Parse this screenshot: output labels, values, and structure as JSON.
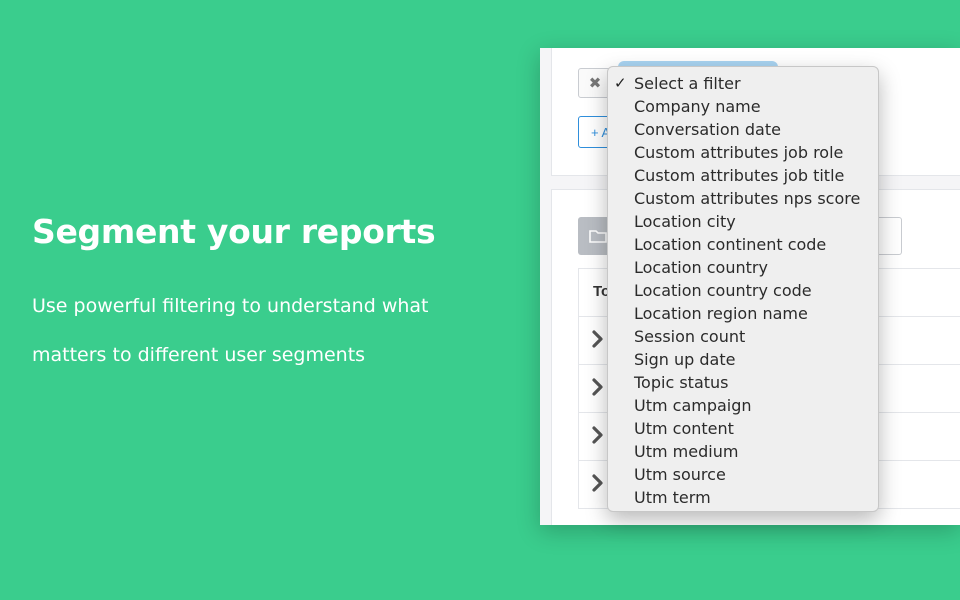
{
  "hero": {
    "title": "Segment your reports",
    "subtitle": "Use powerful filtering to understand what matters to different user segments"
  },
  "filter_panel": {
    "remove_icon": "✖",
    "add_button_label": "+ A"
  },
  "table": {
    "header_label": "To",
    "rows": 4
  },
  "dropdown": {
    "selected_index": 0,
    "check_icon": "✓",
    "options": [
      "Select a filter",
      "Company name",
      "Conversation date",
      "Custom attributes job role",
      "Custom attributes job title",
      "Custom attributes nps score",
      "Location city",
      "Location continent code",
      "Location country",
      "Location country code",
      "Location region name",
      "Session count",
      "Sign up date",
      "Topic status",
      "Utm campaign",
      "Utm content",
      "Utm medium",
      "Utm source",
      "Utm term"
    ]
  },
  "colors": {
    "background": "#3acd8d",
    "accent_blue": "#2f8fdc",
    "dropdown_bg": "#efefef"
  }
}
